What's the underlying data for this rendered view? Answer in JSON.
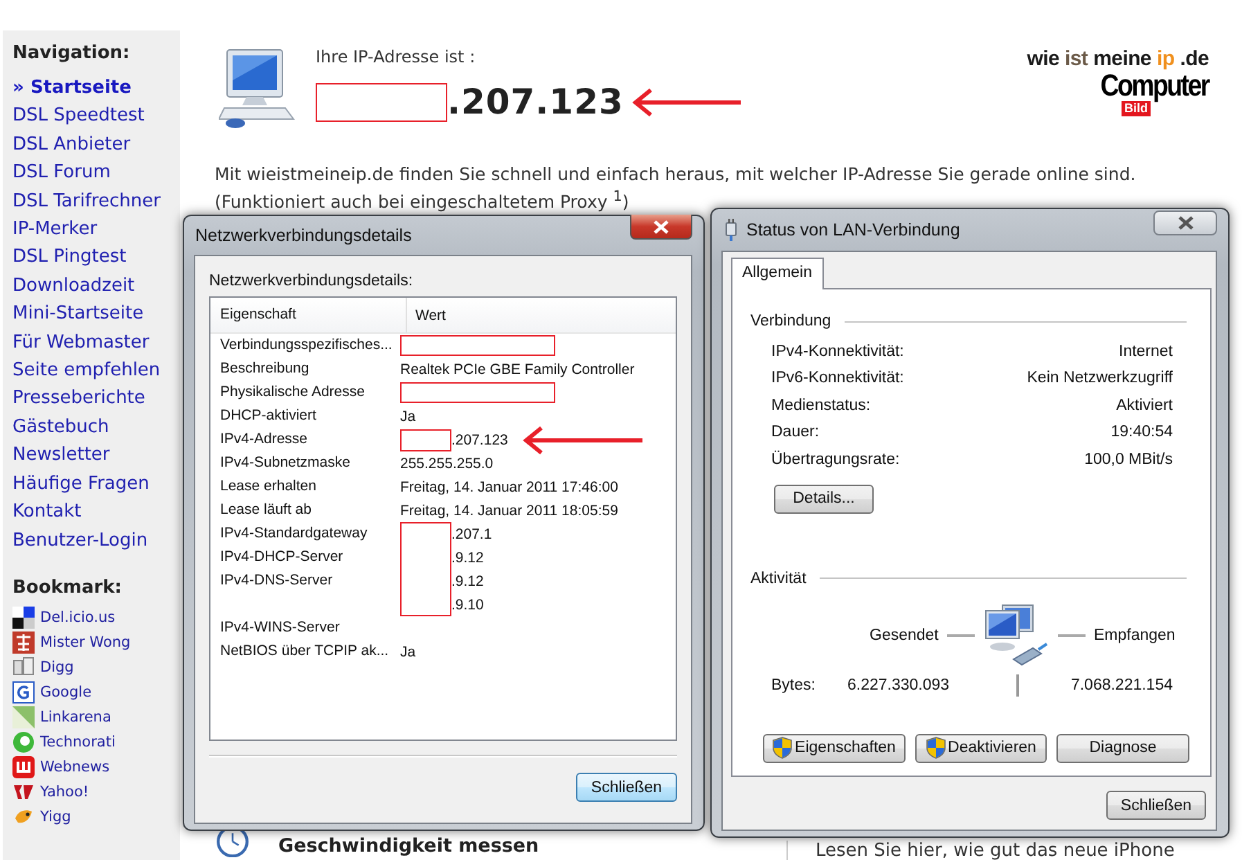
{
  "sidebar": {
    "nav_title": "Navigation:",
    "nav": [
      {
        "label": "Startseite",
        "prefix": "»",
        "selected": true
      },
      {
        "label": "DSL Speedtest",
        "selected": false
      },
      {
        "label": "DSL Anbieter",
        "selected": false
      },
      {
        "label": "DSL Forum",
        "selected": false
      },
      {
        "label": "DSL Tarifrechner",
        "selected": false
      },
      {
        "label": "IP-Merker",
        "selected": false
      },
      {
        "label": "DSL Pingtest",
        "selected": false
      },
      {
        "label": "Downloadzeit",
        "selected": false
      },
      {
        "label": "Mini-Startseite",
        "selected": false
      },
      {
        "label": "Für Webmaster",
        "selected": false
      },
      {
        "label": "Seite empfehlen",
        "selected": false
      },
      {
        "label": "Presseberichte",
        "selected": false
      },
      {
        "label": "Gästebuch",
        "selected": false
      },
      {
        "label": "Newsletter",
        "selected": false
      },
      {
        "label": "Häufige Fragen",
        "selected": false
      },
      {
        "label": "Kontakt",
        "selected": false
      },
      {
        "label": "Benutzer-Login",
        "selected": false
      }
    ],
    "bookmark_title": "Bookmark:",
    "bookmarks": [
      "Del.icio.us",
      "Mister Wong",
      "Digg",
      "Google",
      "Linkarena",
      "Technorati",
      "Webnews",
      "Yahoo!",
      "Yigg"
    ]
  },
  "header": {
    "label": "Ihre IP-Adresse ist :",
    "ip": ".207.123",
    "redacted": true,
    "arrow": true
  },
  "logo": {
    "parts": [
      {
        "text": "wie",
        "color": "#1a1a1a"
      },
      {
        "text": "ist",
        "color": "#6b5a48"
      },
      {
        "text": "meine",
        "color": "#1a1a1a"
      },
      {
        "text": "ip",
        "color": "#f0901e"
      },
      {
        "text": ".de",
        "color": "#1a1a1a"
      }
    ],
    "brand": "Computer",
    "badge": "Bild"
  },
  "intro": {
    "text": "Mit wieistmeineip.de finden Sie schnell und einfach heraus, mit welcher IP-Adresse Sie gerade online sind.",
    "note": "(Funktioniert auch bei eingeschaltetem Proxy $^{1}$)"
  },
  "article": {
    "title": "Geschwindigkeit messen"
  },
  "teaser": "Lesen Sie hier, wie gut das neue iPhone",
  "details_window": {
    "title": "Netzwerkverbindungsdetails",
    "label": "Netzwerkverbindungsdetails:",
    "columns": [
      "Eigenschaft",
      "Wert"
    ],
    "rows": [
      {
        "property": "Verbindungsspezifisches...",
        "redacted": true,
        "arrow": false
      },
      {
        "property": "Beschreibung",
        "value": "Realtek PCIe GBE Family Controller",
        "redacted": false,
        "arrow": false
      },
      {
        "property": "Physikalische Adresse",
        "redacted": true,
        "arrow": false
      },
      {
        "property": "DHCP-aktiviert",
        "value": "Ja",
        "redacted": false,
        "arrow": false
      },
      {
        "property": "IPv4-Adresse",
        "value": ".207.123",
        "redacted": true,
        "arrow": true
      },
      {
        "property": "IPv4-Subnetzmaske",
        "value": "255.255.255.0",
        "redacted": false,
        "arrow": false
      },
      {
        "property": "Lease erhalten",
        "value": "Freitag, 14. Januar 2011 17:46:00",
        "redacted": false,
        "arrow": false
      },
      {
        "property": "Lease läuft ab",
        "value": "Freitag, 14. Januar 2011 18:05:59",
        "redacted": false,
        "arrow": false
      },
      {
        "property": "IPv4-Standardgateway",
        "value": ".207.1",
        "redacted": true,
        "arrow": false
      },
      {
        "property": "IPv4-DHCP-Server",
        "value": ".9.12",
        "redacted": true,
        "arrow": false
      },
      {
        "property": "IPv4-DNS-Server",
        "value": ".9.12",
        "redacted": true,
        "arrow": false
      },
      {
        "value": ".9.10",
        "redacted": true,
        "arrow": false
      },
      {
        "property": "IPv4-WINS-Server",
        "redacted": false,
        "arrow": false
      },
      {
        "property": "NetBIOS über TCPIP ak...",
        "value": "Ja",
        "redacted": false,
        "arrow": false
      }
    ],
    "button": "Schließen"
  },
  "status_window": {
    "title": "Status von LAN-Verbindung",
    "tabs": [
      {
        "label": "Allgemein",
        "selected": true
      }
    ],
    "connection": {
      "title": "Verbindung",
      "rows": [
        {
          "label": "IPv4-Konnektivität:",
          "value": "Internet"
        },
        {
          "label": "IPv6-Konnektivität:",
          "value": "Kein Netzwerkzugriff"
        },
        {
          "label": "Medienstatus:",
          "value": "Aktiviert"
        },
        {
          "label": "Dauer:",
          "value": "19:40:54"
        },
        {
          "label": "Übertragungsrate:",
          "value": "100,0 MBit/s"
        }
      ]
    },
    "details_button": "Details...",
    "activity": {
      "title": "Aktivität",
      "sent_label": "Gesendet",
      "received_label": "Empfangen",
      "bytes_label": "Bytes:",
      "sent": "6.227.330.093",
      "received": "7.068.221.154"
    },
    "buttons": [
      {
        "label": "Eigenschaften",
        "shield": true
      },
      {
        "label": "Deaktivieren",
        "shield": true
      },
      {
        "label": "Diagnose",
        "shield": false
      }
    ],
    "close_button": "Schließen"
  }
}
